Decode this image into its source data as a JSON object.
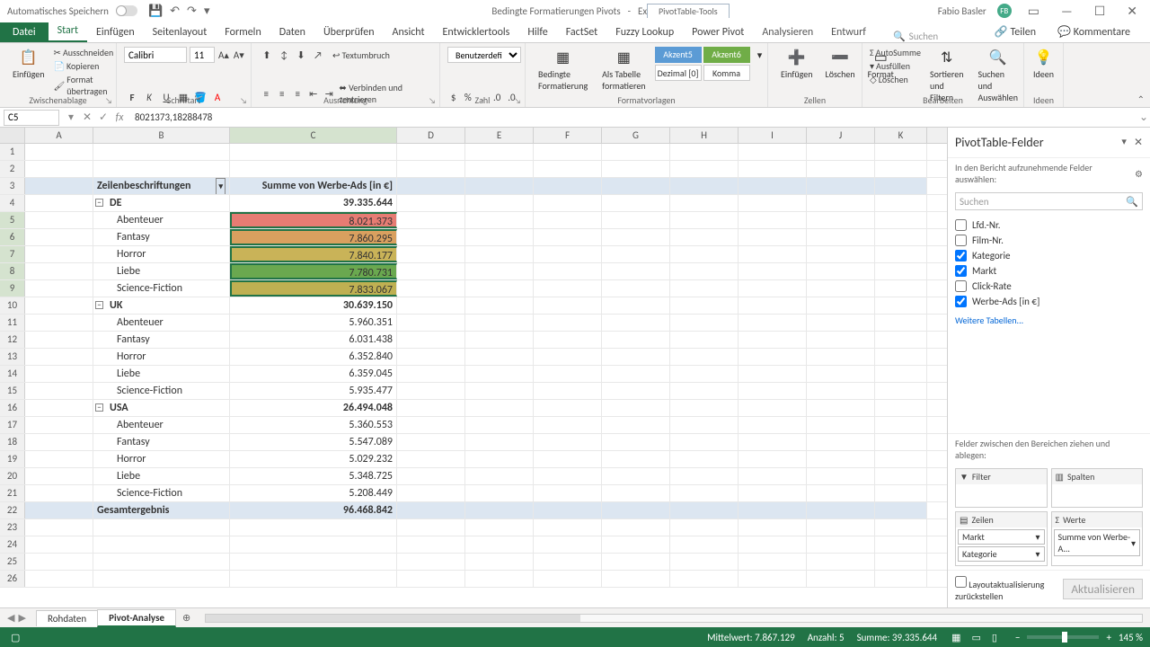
{
  "titlebar": {
    "autosave": "Automatisches Speichern",
    "filename": "Bedingte Formatierungen Pivots",
    "app": "Excel",
    "contextual_tools": "PivotTable-Tools",
    "username": "Fabio Basler"
  },
  "ribbon_tabs": {
    "file": "Datei",
    "home": "Start",
    "insert": "Einfügen",
    "page": "Seitenlayout",
    "formulas": "Formeln",
    "data": "Daten",
    "review": "Überprüfen",
    "view": "Ansicht",
    "dev": "Entwicklertools",
    "help": "Hilfe",
    "factset": "FactSet",
    "fuzzy": "Fuzzy Lookup",
    "powerpivot": "Power Pivot",
    "analyze": "Analysieren",
    "design": "Entwurf",
    "search_placeholder": "Suchen",
    "share": "Teilen",
    "comments": "Kommentare"
  },
  "ribbon": {
    "clipboard": {
      "paste": "Einfügen",
      "cut": "Ausschneiden",
      "copy": "Kopieren",
      "fmt_painter": "Format übertragen",
      "label": "Zwischenablage"
    },
    "font": {
      "family": "Calibri",
      "size": "11",
      "label": "Schriftart"
    },
    "align": {
      "wrap": "Textumbruch",
      "merge": "Verbinden und zentrieren",
      "label": "Ausrichtung"
    },
    "number": {
      "format": "Benutzerdefiniert",
      "dec0": "Dezimal [0]",
      "comma": "Komma",
      "label": "Zahl"
    },
    "styles": {
      "cond": "Bedingte Formatierung",
      "table": "Als Tabelle formatieren",
      "a5": "Akzent5",
      "a6": "Akzent6",
      "label": "Formatvorlagen"
    },
    "cells": {
      "insert": "Einfügen",
      "delete": "Löschen",
      "format": "Format",
      "label": "Zellen"
    },
    "editing": {
      "autosum": "AutoSumme",
      "fill": "Ausfüllen",
      "clear": "Löschen",
      "sort": "Sortieren und Filtern",
      "find": "Suchen und Auswählen",
      "label": "Bearbeiten"
    },
    "ideas": {
      "ideas": "Ideen",
      "label": "Ideen"
    }
  },
  "formula_bar": {
    "namebox": "C5",
    "formula": "8021373,18288478"
  },
  "columns": [
    "A",
    "B",
    "C",
    "D",
    "E",
    "F",
    "G",
    "H",
    "I",
    "J",
    "K"
  ],
  "pivot": {
    "row_label": "Zeilenbeschriftungen",
    "value_label": "Summe von Werbe-Ads [in €]",
    "groups": [
      {
        "name": "DE",
        "total": "39.335.644",
        "rows": [
          {
            "cat": "Abenteuer",
            "val": "8.021.373",
            "cf": "cf-red"
          },
          {
            "cat": "Fantasy",
            "val": "7.860.295",
            "cf": "cf-orng"
          },
          {
            "cat": "Horror",
            "val": "7.840.177",
            "cf": "cf-yel1"
          },
          {
            "cat": "Liebe",
            "val": "7.780.731",
            "cf": "cf-grn"
          },
          {
            "cat": "Science-Fiction",
            "val": "7.833.067",
            "cf": "cf-yel2"
          }
        ]
      },
      {
        "name": "UK",
        "total": "30.639.150",
        "rows": [
          {
            "cat": "Abenteuer",
            "val": "5.960.351"
          },
          {
            "cat": "Fantasy",
            "val": "6.031.438"
          },
          {
            "cat": "Horror",
            "val": "6.352.840"
          },
          {
            "cat": "Liebe",
            "val": "6.359.045"
          },
          {
            "cat": "Science-Fiction",
            "val": "5.935.477"
          }
        ]
      },
      {
        "name": "USA",
        "total": "26.494.048",
        "rows": [
          {
            "cat": "Abenteuer",
            "val": "5.360.553"
          },
          {
            "cat": "Fantasy",
            "val": "5.547.089"
          },
          {
            "cat": "Horror",
            "val": "5.029.232"
          },
          {
            "cat": "Liebe",
            "val": "5.348.725"
          },
          {
            "cat": "Science-Fiction",
            "val": "5.208.449"
          }
        ]
      }
    ],
    "grand_label": "Gesamtergebnis",
    "grand_total": "96.468.842"
  },
  "field_pane": {
    "title": "PivotTable-Felder",
    "hint": "In den Bericht aufzunehmende Felder auswählen:",
    "search_placeholder": "Suchen",
    "fields": [
      {
        "name": "Lfd.-Nr.",
        "checked": false
      },
      {
        "name": "Film-Nr.",
        "checked": false
      },
      {
        "name": "Kategorie",
        "checked": true
      },
      {
        "name": "Markt",
        "checked": true
      },
      {
        "name": "Click-Rate",
        "checked": false
      },
      {
        "name": "Werbe-Ads [in €]",
        "checked": true
      }
    ],
    "more": "Weitere Tabellen...",
    "areas_hint": "Felder zwischen den Bereichen ziehen und ablegen:",
    "areas": {
      "filter": "Filter",
      "columns": "Spalten",
      "rows": "Zeilen",
      "values": "Werte"
    },
    "row_chips": [
      "Markt",
      "Kategorie"
    ],
    "value_chips": [
      "Summe von Werbe-A..."
    ],
    "defer": "Layoutaktualisierung zurückstellen",
    "refresh": "Aktualisieren"
  },
  "sheetbar": {
    "sheets": [
      "Rohdaten",
      "Pivot-Analyse"
    ],
    "active": 1
  },
  "statusbar": {
    "avg_lbl": "Mittelwert:",
    "avg": "7.867.129",
    "cnt_lbl": "Anzahl:",
    "cnt": "5",
    "sum_lbl": "Summe:",
    "sum": "39.335.644",
    "zoom": "145 %"
  }
}
